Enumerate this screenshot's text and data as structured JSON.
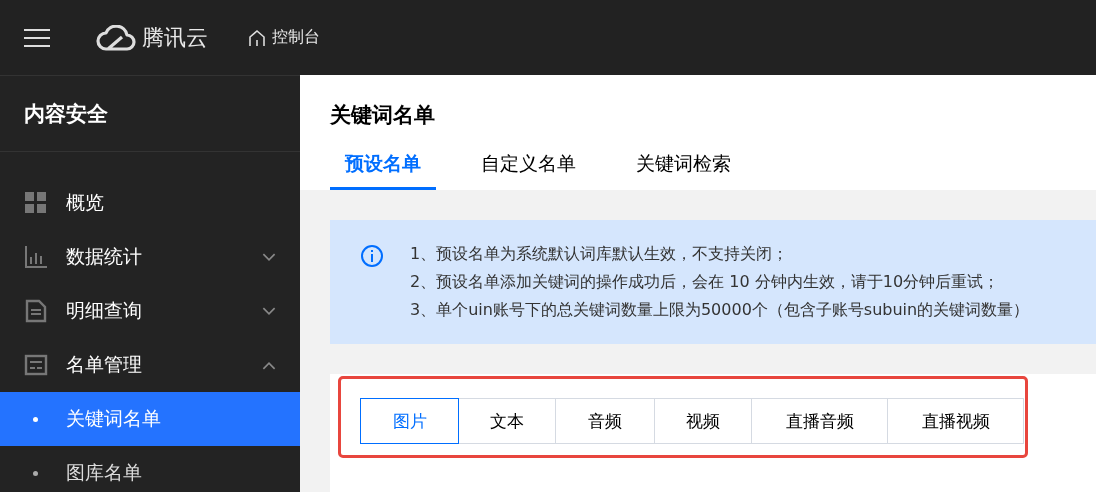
{
  "topbar": {
    "brand": "腾讯云",
    "console": "控制台"
  },
  "sidebar": {
    "title": "内容安全",
    "items": [
      {
        "label": "概览",
        "kind": "link"
      },
      {
        "label": "数据统计",
        "kind": "group",
        "expanded": false
      },
      {
        "label": "明细查询",
        "kind": "group",
        "expanded": false
      },
      {
        "label": "名单管理",
        "kind": "group",
        "expanded": true,
        "children": [
          {
            "label": "关键词名单",
            "selected": true
          },
          {
            "label": "图库名单",
            "selected": false
          }
        ]
      }
    ]
  },
  "page": {
    "title": "关键词名单",
    "tabs": [
      {
        "label": "预设名单",
        "selected": true
      },
      {
        "label": "自定义名单",
        "selected": false
      },
      {
        "label": "关键词检索",
        "selected": false
      }
    ]
  },
  "notice": {
    "lines": [
      "1、预设名单为系统默认词库默认生效，不支持关闭；",
      "2、预设名单添加关键词的操作成功后，会在 10 分钟内生效，请于10分钟后重试；",
      "3、单个uin账号下的总关键词数量上限为50000个（包含子账号subuin的关键词数量）"
    ]
  },
  "types": [
    {
      "label": "图片",
      "selected": true
    },
    {
      "label": "文本",
      "selected": false
    },
    {
      "label": "音频",
      "selected": false
    },
    {
      "label": "视频",
      "selected": false
    },
    {
      "label": "直播音频",
      "selected": false
    },
    {
      "label": "直播视频",
      "selected": false
    }
  ]
}
